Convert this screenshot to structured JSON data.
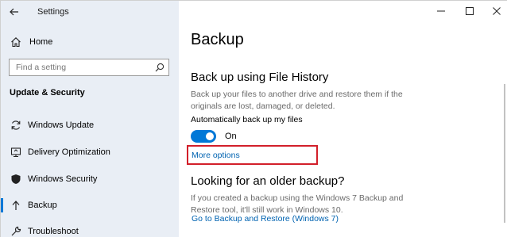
{
  "window": {
    "title": "Settings"
  },
  "sidebar": {
    "home_label": "Home",
    "search_placeholder": "Find a setting",
    "section_title": "Update & Security",
    "items": [
      {
        "label": "Windows Update",
        "icon": "refresh-icon"
      },
      {
        "label": "Delivery Optimization",
        "icon": "delivery-optimization-icon"
      },
      {
        "label": "Windows Security",
        "icon": "shield-icon"
      },
      {
        "label": "Backup",
        "icon": "backup-arrow-icon",
        "selected": true
      },
      {
        "label": "Troubleshoot",
        "icon": "wrench-icon"
      }
    ]
  },
  "main": {
    "page_title": "Backup",
    "file_history": {
      "heading": "Back up using File History",
      "description": "Back up your files to another drive and restore them if the originals are lost, damaged, or deleted.",
      "auto_label": "Automatically back up my files",
      "toggle_state": "On",
      "more_options": "More options"
    },
    "older_backup": {
      "heading": "Looking for an older backup?",
      "description": "If you created a backup using the Windows 7 Backup and Restore tool, it'll still work in Windows 10.",
      "link": "Go to Backup and Restore (Windows 7)"
    }
  },
  "colors": {
    "accent": "#0078d7",
    "link": "#0063b1",
    "sidebar_bg": "#e9eef5",
    "highlight_box": "#d21f2a"
  }
}
